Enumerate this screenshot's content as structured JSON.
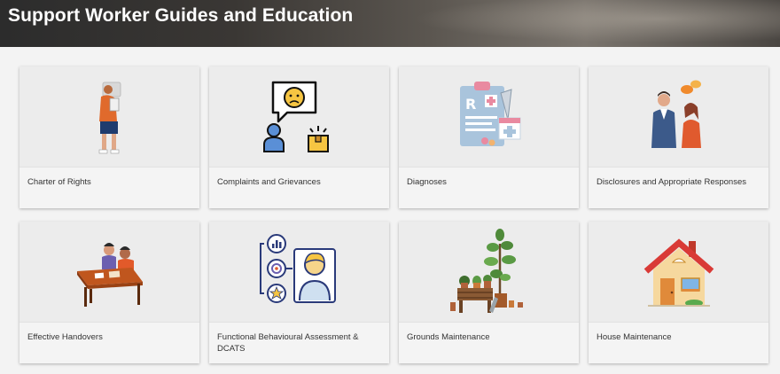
{
  "header": {
    "title": "Support Worker Guides and Education"
  },
  "cards": [
    {
      "label": "Charter of Rights",
      "icon": "person-reading-icon"
    },
    {
      "label": "Complaints and Grievances",
      "icon": "complaint-speech-icon"
    },
    {
      "label": "Diagnoses",
      "icon": "medical-clipboard-icon"
    },
    {
      "label": "Disclosures and Appropriate Responses",
      "icon": "conversation-icon"
    },
    {
      "label": "Effective Handovers",
      "icon": "desk-meeting-icon"
    },
    {
      "label": "Functional Behavioural Assessment & DCATS",
      "icon": "assessment-profile-icon"
    },
    {
      "label": "Grounds Maintenance",
      "icon": "garden-plants-icon"
    },
    {
      "label": "House Maintenance",
      "icon": "house-icon"
    }
  ]
}
